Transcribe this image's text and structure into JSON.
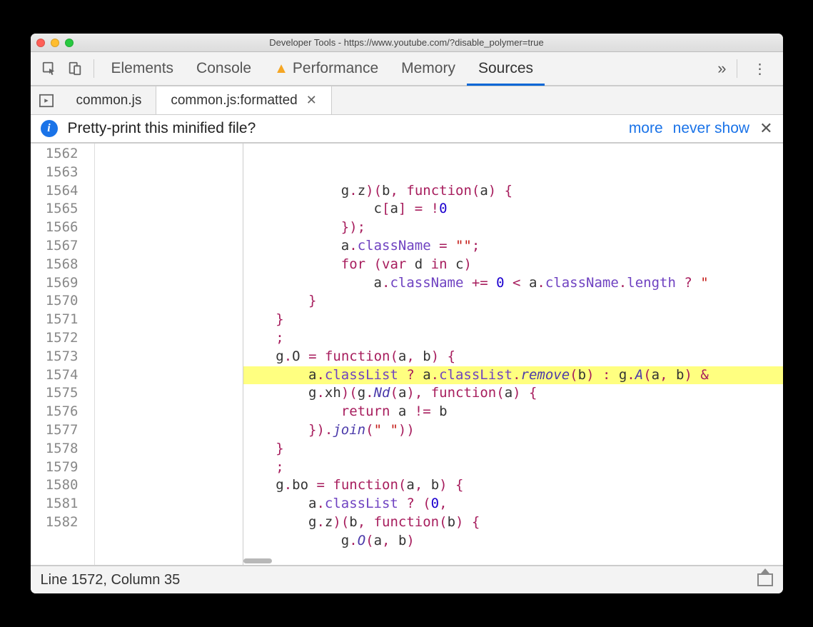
{
  "window": {
    "title": "Developer Tools - https://www.youtube.com/?disable_polymer=true"
  },
  "panels": {
    "elements": "Elements",
    "console": "Console",
    "performance": "Performance",
    "memory": "Memory",
    "sources": "Sources"
  },
  "file_tabs": {
    "tab1": "common.js",
    "tab2": "common.js:formatted"
  },
  "infobar": {
    "message": "Pretty-print this minified file?",
    "more": "more",
    "nevershow": "never show"
  },
  "gutter": {
    "start": 1562,
    "end": 1582
  },
  "code_lines": [
    {
      "n": 1562,
      "indent": 12,
      "tokens": [
        [
          "id",
          "g"
        ],
        [
          "op",
          "."
        ],
        [
          "id",
          "z"
        ],
        [
          "op",
          ")("
        ],
        [
          "id",
          "b"
        ],
        [
          "op",
          ", "
        ],
        [
          "kw",
          "function"
        ],
        [
          "op",
          "("
        ],
        [
          "id",
          "a"
        ],
        [
          "op",
          ") {"
        ]
      ]
    },
    {
      "n": 1563,
      "indent": 16,
      "tokens": [
        [
          "id",
          "c"
        ],
        [
          "op",
          "["
        ],
        [
          "id",
          "a"
        ],
        [
          "op",
          "] "
        ],
        [
          "op",
          "= "
        ],
        [
          "op",
          "!"
        ],
        [
          "num",
          "0"
        ]
      ]
    },
    {
      "n": 1564,
      "indent": 12,
      "tokens": [
        [
          "op",
          "});"
        ]
      ]
    },
    {
      "n": 1565,
      "indent": 12,
      "tokens": [
        [
          "id",
          "a"
        ],
        [
          "op",
          "."
        ],
        [
          "prop",
          "className"
        ],
        [
          "op",
          " = "
        ],
        [
          "str",
          "\"\""
        ],
        [
          "op",
          ";"
        ]
      ]
    },
    {
      "n": 1566,
      "indent": 12,
      "tokens": [
        [
          "kw",
          "for"
        ],
        [
          "op",
          " ("
        ],
        [
          "kw",
          "var"
        ],
        [
          "id",
          " d "
        ],
        [
          "kw",
          "in"
        ],
        [
          "id",
          " c"
        ],
        [
          "op",
          ")"
        ]
      ]
    },
    {
      "n": 1567,
      "indent": 16,
      "tokens": [
        [
          "id",
          "a"
        ],
        [
          "op",
          "."
        ],
        [
          "prop",
          "className"
        ],
        [
          "op",
          " += "
        ],
        [
          "num",
          "0"
        ],
        [
          "op",
          " < "
        ],
        [
          "id",
          "a"
        ],
        [
          "op",
          "."
        ],
        [
          "prop",
          "className"
        ],
        [
          "op",
          "."
        ],
        [
          "prop",
          "length"
        ],
        [
          "op",
          " ? "
        ],
        [
          "str",
          "\""
        ]
      ]
    },
    {
      "n": 1568,
      "indent": 8,
      "tokens": [
        [
          "op",
          "}"
        ]
      ]
    },
    {
      "n": 1569,
      "indent": 4,
      "tokens": [
        [
          "op",
          "}"
        ]
      ]
    },
    {
      "n": 1570,
      "indent": 4,
      "tokens": [
        [
          "op",
          ";"
        ]
      ]
    },
    {
      "n": 1571,
      "indent": 4,
      "tokens": [
        [
          "id",
          "g"
        ],
        [
          "op",
          "."
        ],
        [
          "id",
          "O"
        ],
        [
          "op",
          " = "
        ],
        [
          "kw",
          "function"
        ],
        [
          "op",
          "("
        ],
        [
          "id",
          "a"
        ],
        [
          "op",
          ", "
        ],
        [
          "id",
          "b"
        ],
        [
          "op",
          ") {"
        ]
      ]
    },
    {
      "n": 1572,
      "indent": 8,
      "hl": true,
      "tokens": [
        [
          "id",
          "a"
        ],
        [
          "op",
          "."
        ],
        [
          "prop",
          "classList"
        ],
        [
          "op",
          " ? "
        ],
        [
          "id",
          "a"
        ],
        [
          "op",
          "."
        ],
        [
          "prop",
          "classList"
        ],
        [
          "op",
          "."
        ],
        [
          "fn",
          "remove"
        ],
        [
          "op",
          "("
        ],
        [
          "id",
          "b"
        ],
        [
          "op",
          ") : "
        ],
        [
          "id",
          "g"
        ],
        [
          "op",
          "."
        ],
        [
          "fn",
          "A"
        ],
        [
          "op",
          "("
        ],
        [
          "id",
          "a"
        ],
        [
          "op",
          ", "
        ],
        [
          "id",
          "b"
        ],
        [
          "op",
          ") &"
        ]
      ]
    },
    {
      "n": 1573,
      "indent": 8,
      "tokens": [
        [
          "id",
          "g"
        ],
        [
          "op",
          "."
        ],
        [
          "id",
          "xh"
        ],
        [
          "op",
          ")("
        ],
        [
          "id",
          "g"
        ],
        [
          "op",
          "."
        ],
        [
          "fn",
          "Nd"
        ],
        [
          "op",
          "("
        ],
        [
          "id",
          "a"
        ],
        [
          "op",
          "), "
        ],
        [
          "kw",
          "function"
        ],
        [
          "op",
          "("
        ],
        [
          "id",
          "a"
        ],
        [
          "op",
          ") {"
        ]
      ]
    },
    {
      "n": 1574,
      "indent": 12,
      "tokens": [
        [
          "kw",
          "return"
        ],
        [
          "id",
          " a "
        ],
        [
          "op",
          "!= "
        ],
        [
          "id",
          "b"
        ]
      ]
    },
    {
      "n": 1575,
      "indent": 8,
      "tokens": [
        [
          "op",
          "})."
        ],
        [
          "fn",
          "join"
        ],
        [
          "op",
          "("
        ],
        [
          "str",
          "\" \""
        ],
        [
          "op",
          "))"
        ]
      ]
    },
    {
      "n": 1576,
      "indent": 4,
      "tokens": [
        [
          "op",
          "}"
        ]
      ]
    },
    {
      "n": 1577,
      "indent": 4,
      "tokens": [
        [
          "op",
          ";"
        ]
      ]
    },
    {
      "n": 1578,
      "indent": 4,
      "tokens": [
        [
          "id",
          "g"
        ],
        [
          "op",
          "."
        ],
        [
          "id",
          "bo"
        ],
        [
          "op",
          " = "
        ],
        [
          "kw",
          "function"
        ],
        [
          "op",
          "("
        ],
        [
          "id",
          "a"
        ],
        [
          "op",
          ", "
        ],
        [
          "id",
          "b"
        ],
        [
          "op",
          ") {"
        ]
      ]
    },
    {
      "n": 1579,
      "indent": 8,
      "tokens": [
        [
          "id",
          "a"
        ],
        [
          "op",
          "."
        ],
        [
          "prop",
          "classList"
        ],
        [
          "op",
          " ? ("
        ],
        [
          "num",
          "0"
        ],
        [
          "op",
          ","
        ]
      ]
    },
    {
      "n": 1580,
      "indent": 8,
      "tokens": [
        [
          "id",
          "g"
        ],
        [
          "op",
          "."
        ],
        [
          "id",
          "z"
        ],
        [
          "op",
          ")("
        ],
        [
          "id",
          "b"
        ],
        [
          "op",
          ", "
        ],
        [
          "kw",
          "function"
        ],
        [
          "op",
          "("
        ],
        [
          "id",
          "b"
        ],
        [
          "op",
          ") {"
        ]
      ]
    },
    {
      "n": 1581,
      "indent": 12,
      "tokens": [
        [
          "id",
          "g"
        ],
        [
          "op",
          "."
        ],
        [
          "fn",
          "O"
        ],
        [
          "op",
          "("
        ],
        [
          "id",
          "a"
        ],
        [
          "op",
          ", "
        ],
        [
          "id",
          "b"
        ],
        [
          "op",
          ")"
        ]
      ]
    },
    {
      "n": 1582,
      "indent": 0,
      "tokens": []
    }
  ],
  "status": {
    "text": "Line 1572, Column 35"
  }
}
